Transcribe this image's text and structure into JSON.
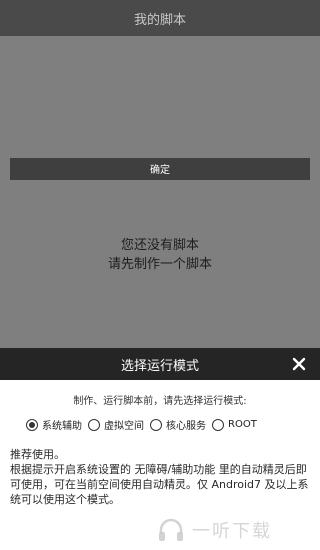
{
  "header": {
    "title": "我的脚本"
  },
  "empty_state": {
    "line1": "您还没有脚本",
    "line2": "请先制作一个脚本"
  },
  "dialog": {
    "title": "选择运行模式",
    "close_icon": "close-icon",
    "prompt": "制作、运行脚本前，请先选择运行模式:",
    "options": [
      {
        "label": "系统辅助",
        "selected": true
      },
      {
        "label": "虚拟空间",
        "selected": false
      },
      {
        "label": "核心服务",
        "selected": false
      },
      {
        "label": "ROOT",
        "selected": false
      }
    ],
    "description": {
      "line1": "推荐使用。",
      "line2": "根据提示开启系统设置的 无障碍/辅助功能 里的自动精灵后即可使用，可在当前空间使用自动精灵。仅 Android7 及以上系统可以使用这个模式。"
    },
    "confirm_label": "确定"
  },
  "watermark": {
    "text": "一听下载",
    "logo_icon": "headphones-logo-icon"
  }
}
